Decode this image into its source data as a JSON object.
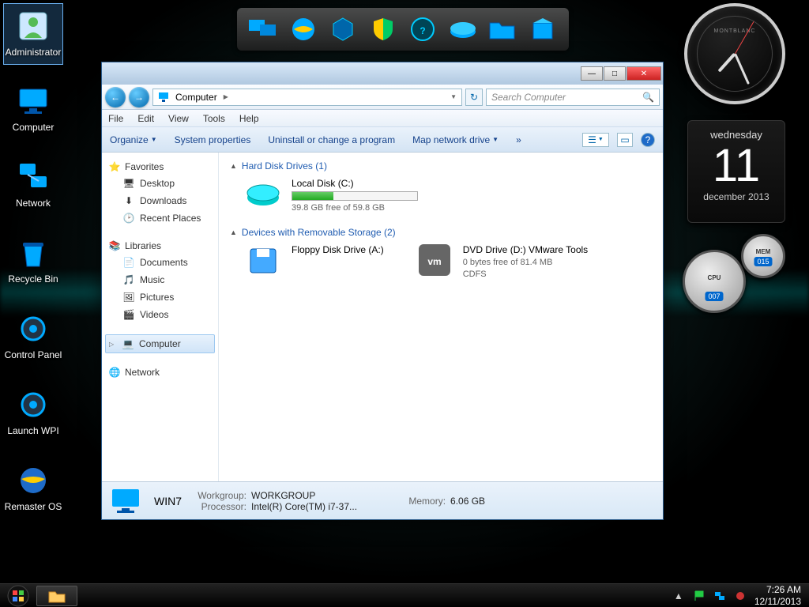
{
  "desktop_icons": [
    {
      "label": "Administrator",
      "selected": true
    },
    {
      "label": "Computer"
    },
    {
      "label": "Network"
    },
    {
      "label": "Recycle Bin"
    },
    {
      "label": "Control Panel"
    },
    {
      "label": "Launch WPI"
    },
    {
      "label": "Remaster OS"
    }
  ],
  "calendar": {
    "dow": "wednesday",
    "day": "11",
    "month_year": "december 2013"
  },
  "clock_brand": "MONTBLANC",
  "cpu_gauge": {
    "label": "CPU",
    "value": "007"
  },
  "mem_gauge": {
    "label": "MEM",
    "value": "015"
  },
  "window": {
    "nav": {
      "back": "←",
      "fwd": "→"
    },
    "breadcrumb": [
      "Computer"
    ],
    "search_placeholder": "Search Computer",
    "menus": [
      "File",
      "Edit",
      "View",
      "Tools",
      "Help"
    ],
    "toolbar": {
      "organize": "Organize",
      "sysprops": "System properties",
      "uninstall": "Uninstall or change a program",
      "mapdrive": "Map network drive",
      "more": "»"
    },
    "sidebar": {
      "favorites": {
        "header": "Favorites",
        "items": [
          "Desktop",
          "Downloads",
          "Recent Places"
        ]
      },
      "libraries": {
        "header": "Libraries",
        "items": [
          "Documents",
          "Music",
          "Pictures",
          "Videos"
        ]
      },
      "computer": "Computer",
      "network": "Network"
    },
    "content": {
      "hdd_header": "Hard Disk Drives (1)",
      "hdd": {
        "name": "Local Disk (C:)",
        "free": "39.8 GB free of 59.8 GB",
        "pct": 33
      },
      "dev_header": "Devices with Removable Storage (2)",
      "floppy": {
        "name": "Floppy Disk Drive (A:)"
      },
      "dvd": {
        "name": "DVD Drive (D:) VMware Tools",
        "free": "0 bytes free of 81.4 MB",
        "fs": "CDFS"
      }
    },
    "status": {
      "name": "WIN7",
      "workgroup_label": "Workgroup:",
      "workgroup": "WORKGROUP",
      "processor_label": "Processor:",
      "processor": "Intel(R) Core(TM) i7-37...",
      "memory_label": "Memory:",
      "memory": "6.06 GB"
    }
  },
  "tray": {
    "time": "7:26 AM",
    "date": "12/11/2013"
  }
}
